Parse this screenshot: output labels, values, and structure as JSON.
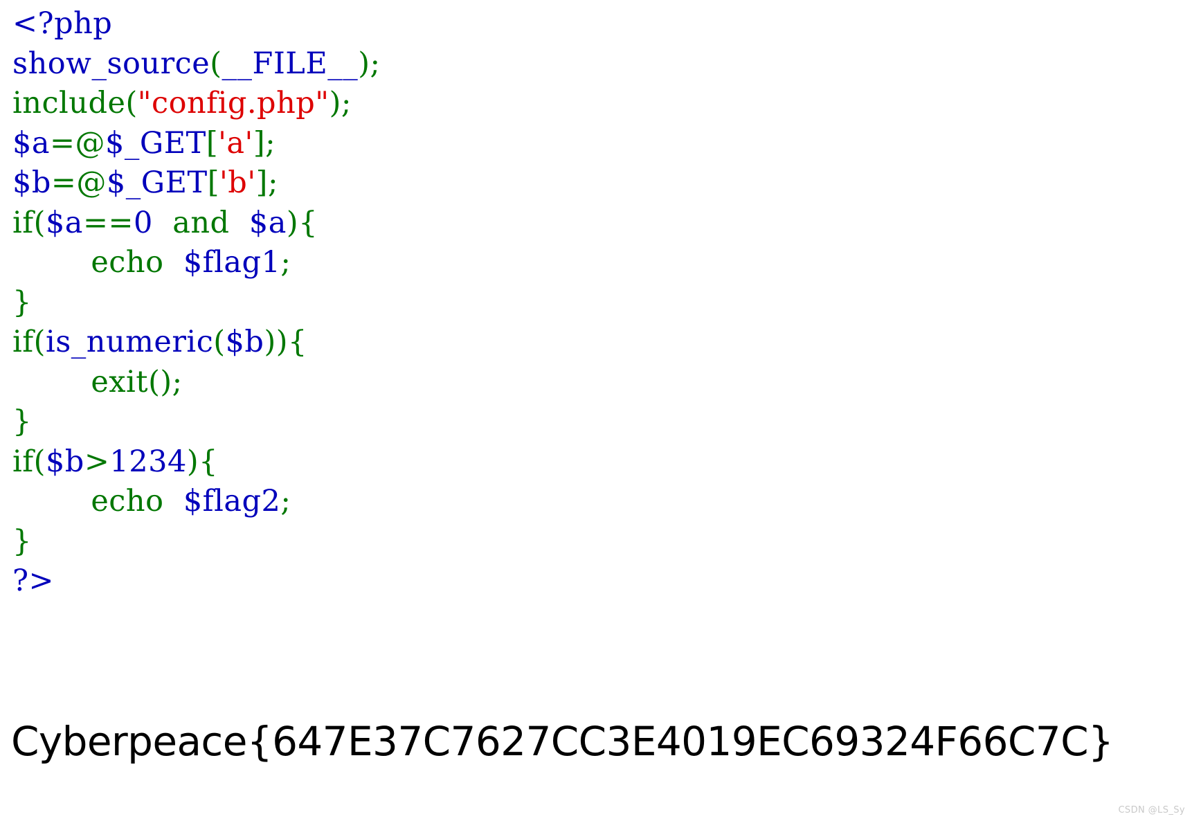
{
  "page": {
    "background_color": "#ffffff",
    "kind": "php-source-listing-with-flag-output"
  },
  "palette": {
    "php_tag_blue": "#0000BB",
    "keyword_green": "#007700",
    "string_red": "#DD0000",
    "variable_blue": "#0000BB",
    "flag_text": "#000000",
    "watermark": "#c9c9c9"
  },
  "source": {
    "language": "php",
    "plain_text": "<?php\nshow_source(__FILE__);\ninclude(\"config.php\");\n$a=@$_GET['a'];\n$b=@$_GET['b'];\nif($a==0  and  $a){\n        echo  $flag1;\n}\nif(is_numeric($b)){\n        exit();\n}\nif($b>1234){\n        echo  $flag2;\n}\n?>",
    "lines": [
      {
        "n": 1,
        "tokens": [
          {
            "t": "<?php",
            "c": "tok-default"
          }
        ]
      },
      {
        "n": 2,
        "tokens": [
          {
            "t": "show_source",
            "c": "tok-var"
          },
          {
            "t": "(",
            "c": "tok-kw"
          },
          {
            "t": "__FILE__",
            "c": "tok-var"
          },
          {
            "t": ")",
            "c": "tok-kw"
          },
          {
            "t": ";",
            "c": "tok-kw"
          }
        ]
      },
      {
        "n": 3,
        "tokens": [
          {
            "t": "include",
            "c": "tok-kw"
          },
          {
            "t": "(",
            "c": "tok-kw"
          },
          {
            "t": "\"config.php\"",
            "c": "tok-str"
          },
          {
            "t": ")",
            "c": "tok-kw"
          },
          {
            "t": ";",
            "c": "tok-kw"
          }
        ]
      },
      {
        "n": 4,
        "tokens": [
          {
            "t": "$a",
            "c": "tok-var"
          },
          {
            "t": "=@",
            "c": "tok-kw"
          },
          {
            "t": "$_GET",
            "c": "tok-var"
          },
          {
            "t": "[",
            "c": "tok-kw"
          },
          {
            "t": "'a'",
            "c": "tok-str"
          },
          {
            "t": "]",
            "c": "tok-kw"
          },
          {
            "t": ";",
            "c": "tok-kw"
          }
        ]
      },
      {
        "n": 5,
        "tokens": [
          {
            "t": "$b",
            "c": "tok-var"
          },
          {
            "t": "=@",
            "c": "tok-kw"
          },
          {
            "t": "$_GET",
            "c": "tok-var"
          },
          {
            "t": "[",
            "c": "tok-kw"
          },
          {
            "t": "'b'",
            "c": "tok-str"
          },
          {
            "t": "]",
            "c": "tok-kw"
          },
          {
            "t": ";",
            "c": "tok-kw"
          }
        ]
      },
      {
        "n": 6,
        "tokens": [
          {
            "t": "if",
            "c": "tok-kw"
          },
          {
            "t": "(",
            "c": "tok-kw"
          },
          {
            "t": "$a",
            "c": "tok-var"
          },
          {
            "t": "==",
            "c": "tok-kw"
          },
          {
            "t": "0",
            "c": "tok-var"
          },
          {
            "t": "  ",
            "c": "tok-kw"
          },
          {
            "t": "and",
            "c": "tok-kw"
          },
          {
            "t": "  ",
            "c": "tok-kw"
          },
          {
            "t": "$a",
            "c": "tok-var"
          },
          {
            "t": ")",
            "c": "tok-kw"
          },
          {
            "t": "{",
            "c": "tok-kw"
          }
        ]
      },
      {
        "n": 7,
        "tokens": [
          {
            "t": "        ",
            "c": "tok-kw"
          },
          {
            "t": "echo",
            "c": "tok-kw"
          },
          {
            "t": "  ",
            "c": "tok-kw"
          },
          {
            "t": "$flag1",
            "c": "tok-var"
          },
          {
            "t": ";",
            "c": "tok-kw"
          }
        ]
      },
      {
        "n": 8,
        "tokens": [
          {
            "t": "}",
            "c": "tok-kw"
          }
        ]
      },
      {
        "n": 9,
        "tokens": [
          {
            "t": "if",
            "c": "tok-kw"
          },
          {
            "t": "(",
            "c": "tok-kw"
          },
          {
            "t": "is_numeric",
            "c": "tok-var"
          },
          {
            "t": "(",
            "c": "tok-kw"
          },
          {
            "t": "$b",
            "c": "tok-var"
          },
          {
            "t": ")",
            "c": "tok-kw"
          },
          {
            "t": ")",
            "c": "tok-kw"
          },
          {
            "t": "{",
            "c": "tok-kw"
          }
        ]
      },
      {
        "n": 10,
        "tokens": [
          {
            "t": "        ",
            "c": "tok-kw"
          },
          {
            "t": "exit",
            "c": "tok-kw"
          },
          {
            "t": "(",
            "c": "tok-kw"
          },
          {
            "t": ")",
            "c": "tok-kw"
          },
          {
            "t": ";",
            "c": "tok-kw"
          }
        ]
      },
      {
        "n": 11,
        "tokens": [
          {
            "t": "}",
            "c": "tok-kw"
          }
        ]
      },
      {
        "n": 12,
        "tokens": [
          {
            "t": "if",
            "c": "tok-kw"
          },
          {
            "t": "(",
            "c": "tok-kw"
          },
          {
            "t": "$b",
            "c": "tok-var"
          },
          {
            "t": ">",
            "c": "tok-kw"
          },
          {
            "t": "1234",
            "c": "tok-var"
          },
          {
            "t": ")",
            "c": "tok-kw"
          },
          {
            "t": "{",
            "c": "tok-kw"
          }
        ]
      },
      {
        "n": 13,
        "tokens": [
          {
            "t": "        ",
            "c": "tok-kw"
          },
          {
            "t": "echo",
            "c": "tok-kw"
          },
          {
            "t": "  ",
            "c": "tok-kw"
          },
          {
            "t": "$flag2",
            "c": "tok-var"
          },
          {
            "t": ";",
            "c": "tok-kw"
          }
        ]
      },
      {
        "n": 14,
        "tokens": [
          {
            "t": "}",
            "c": "tok-kw"
          }
        ]
      },
      {
        "n": 15,
        "tokens": [
          {
            "t": "?>",
            "c": "tok-default"
          }
        ]
      }
    ]
  },
  "output": {
    "flag": "Cyberpeace{647E37C7627CC3E4019EC69324F66C7C}"
  },
  "watermark": {
    "text": "CSDN @LS_Sy"
  }
}
